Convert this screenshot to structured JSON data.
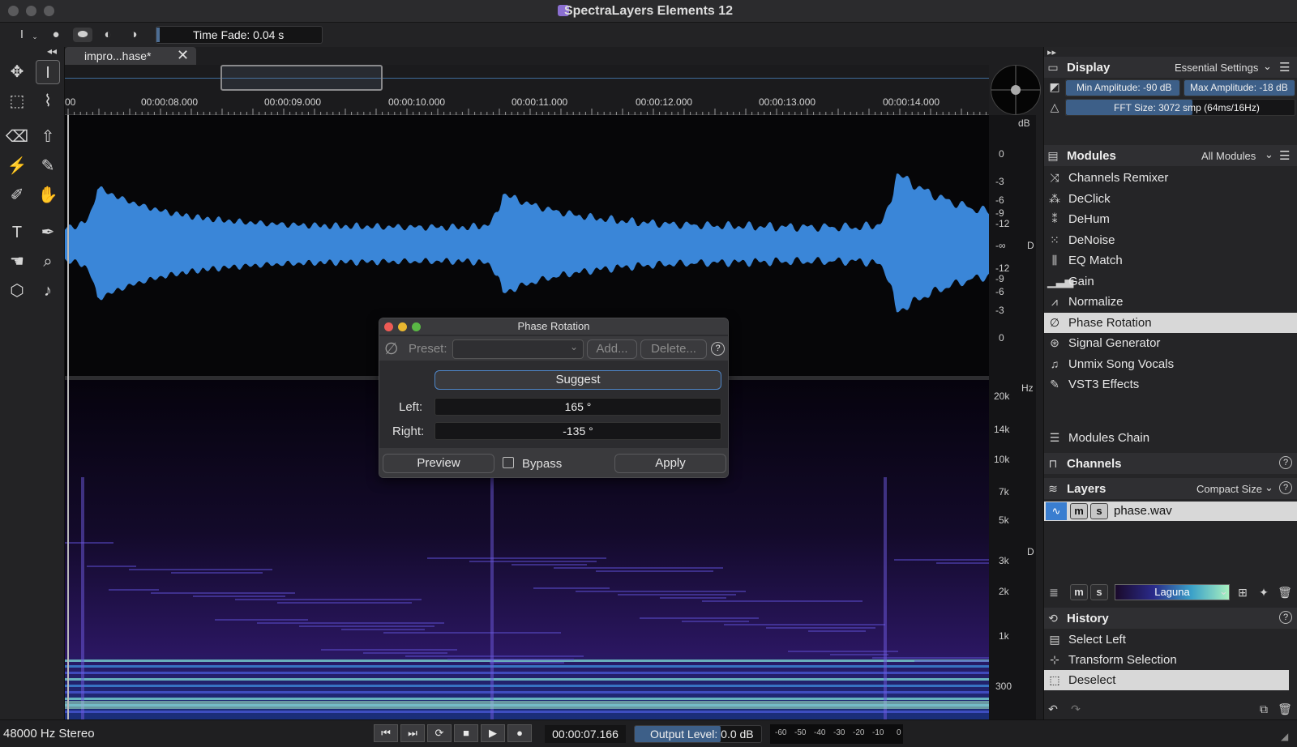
{
  "window": {
    "title": "SpectraLayers Elements 12"
  },
  "toolbar": {
    "time_fade": "Time Fade: 0.04 s"
  },
  "tab": {
    "label": "impro...hase*",
    "close": "✕"
  },
  "ruler": {
    "labels": [
      "00",
      "00:00:08.000",
      "00:00:09.000",
      "00:00:10.000",
      "00:00:11.000",
      "00:00:12.000",
      "00:00:13.000",
      "00:00:14.000"
    ]
  },
  "scale": {
    "db_unit": "dB",
    "db_labels": [
      "0",
      "-3",
      "-6",
      "-9",
      "-12",
      "-∞",
      "-12",
      "-9",
      "-6",
      "-3",
      "0"
    ],
    "hz_unit": "Hz",
    "hz_labels": [
      "20k",
      "14k",
      "10k",
      "7k",
      "5k",
      "3k",
      "2k",
      "1k",
      "300"
    ],
    "d_top": "D",
    "d_bottom": "D"
  },
  "display": {
    "title": "Display",
    "preset": "Essential Settings",
    "min_amplitude": "Min Amplitude: -90 dB",
    "max_amplitude": "Max Amplitude: -18 dB",
    "fft_size": "FFT Size: 3072 smp (64ms/16Hz)"
  },
  "modules": {
    "title": "Modules",
    "filter": "All Modules",
    "items": [
      {
        "label": "Channels Remixer",
        "icon": "⤨"
      },
      {
        "label": "DeClick",
        "icon": "⁂"
      },
      {
        "label": "DeHum",
        "icon": "⁑"
      },
      {
        "label": "DeNoise",
        "icon": "⁙"
      },
      {
        "label": "EQ Match",
        "icon": "⫼"
      },
      {
        "label": "Gain",
        "icon": "▁▃▅"
      },
      {
        "label": "Normalize",
        "icon": "⩘"
      },
      {
        "label": "Phase Rotation",
        "icon": "∅"
      },
      {
        "label": "Signal Generator",
        "icon": "⊛"
      },
      {
        "label": "Unmix Song Vocals",
        "icon": "♫"
      },
      {
        "label": "VST3 Effects",
        "icon": "✎"
      }
    ],
    "chain": "Modules Chain"
  },
  "channels": {
    "title": "Channels",
    "help": "?"
  },
  "layers": {
    "title": "Layers",
    "size": "Compact Size",
    "help": "?",
    "layer_name": "phase.wav",
    "m": "m",
    "s": "s",
    "colormap": "Laguna"
  },
  "history": {
    "title": "History",
    "help": "?",
    "items": [
      "Select Left",
      "Transform Selection",
      "Deselect"
    ]
  },
  "dialog": {
    "title": "Phase Rotation",
    "preset_label": "Preset:",
    "add": "Add...",
    "delete": "Delete...",
    "help": "?",
    "suggest": "Suggest",
    "left_label": "Left:",
    "left_value": "165 °",
    "right_label": "Right:",
    "right_value": "-135 °",
    "preview": "Preview",
    "bypass": "Bypass",
    "apply": "Apply"
  },
  "statusbar": {
    "format": "48000 Hz Stereo",
    "position": "00:00:07.166",
    "output_level": "Output Level: 0.0 dB",
    "meter_labels": [
      "-60",
      "-50",
      "-40",
      "-30",
      "-20",
      "-10",
      "0"
    ]
  },
  "colors": {
    "accent": "#3d5f88",
    "waveform": "#3a86d8",
    "selected_row": "#d8d8d8"
  }
}
